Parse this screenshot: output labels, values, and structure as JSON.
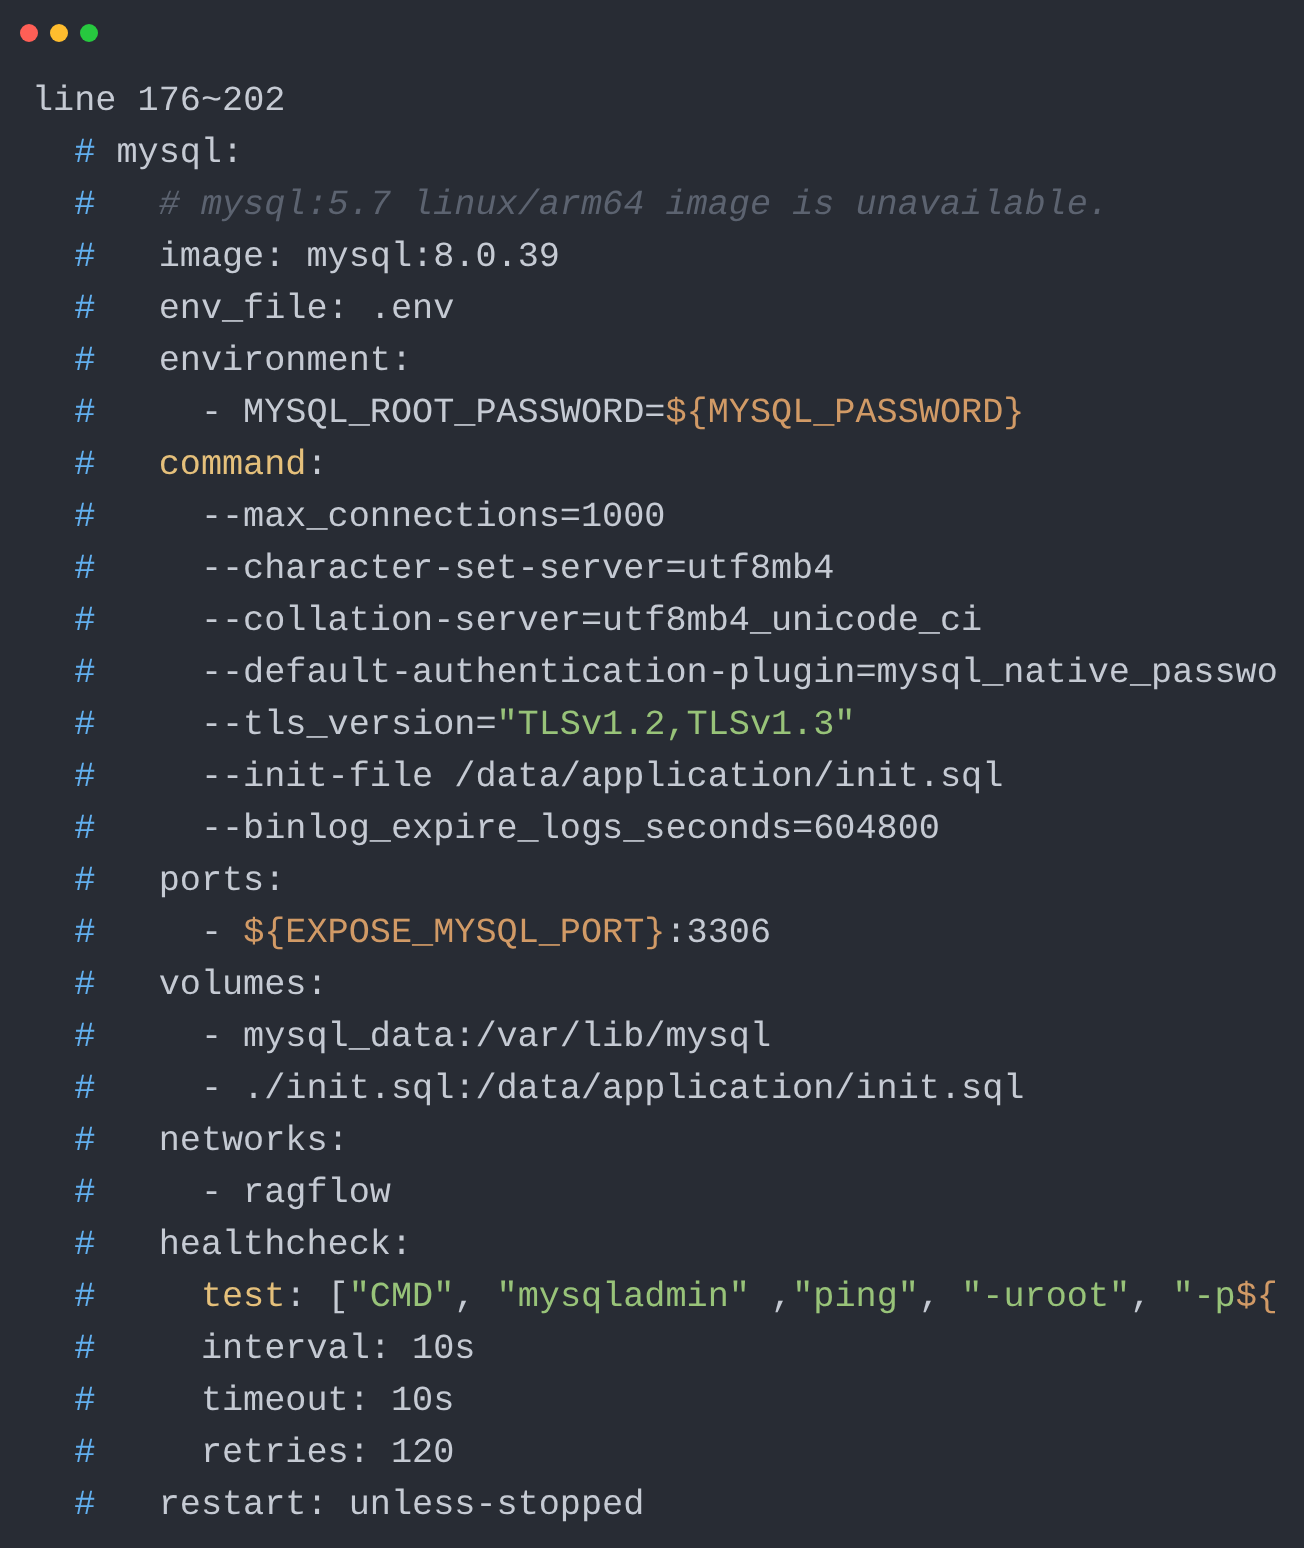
{
  "window": {
    "controls": [
      {
        "color": "#ff5f56"
      },
      {
        "color": "#ffbd2e"
      },
      {
        "color": "#27c93f"
      }
    ]
  },
  "header": "line 176~202",
  "lines": [
    {
      "marker": "#",
      "tokens": [
        {
          "kind": "plain",
          "text": "mysql:"
        }
      ],
      "children": [
        {
          "marker": "#",
          "tokens": [
            {
              "kind": "comment",
              "text": "# mysql:5.7 linux/arm64 image is unavailable."
            }
          ]
        },
        {
          "marker": "#",
          "tokens": [
            {
              "kind": "plain",
              "text": "image: mysql:8.0.39"
            }
          ]
        },
        {
          "marker": "#",
          "tokens": [
            {
              "kind": "plain",
              "text": "env_file: .env"
            }
          ]
        },
        {
          "marker": "#",
          "tokens": [
            {
              "kind": "plain",
              "text": "environment:"
            }
          ],
          "children": [
            {
              "marker": "#",
              "tokens": [
                {
                  "kind": "plain",
                  "text": "- MYSQL_ROOT_PASSWORD="
                },
                {
                  "kind": "variable",
                  "text": "${MYSQL_PASSWORD}"
                }
              ]
            }
          ]
        },
        {
          "marker": "#",
          "tokens": [
            {
              "kind": "key",
              "text": "command"
            },
            {
              "kind": "plain",
              "text": ":"
            }
          ],
          "children": [
            {
              "marker": "#",
              "tokens": [
                {
                  "kind": "plain",
                  "text": "--max_connections=1000"
                }
              ]
            },
            {
              "marker": "#",
              "tokens": [
                {
                  "kind": "plain",
                  "text": "--character-set-server=utf8mb4"
                }
              ]
            },
            {
              "marker": "#",
              "tokens": [
                {
                  "kind": "plain",
                  "text": "--collation-server=utf8mb4_unicode_ci"
                }
              ]
            },
            {
              "marker": "#",
              "tokens": [
                {
                  "kind": "plain",
                  "text": "--default-authentication-plugin=mysql_native_passwo"
                }
              ]
            },
            {
              "marker": "#",
              "tokens": [
                {
                  "kind": "plain",
                  "text": "--tls_version="
                },
                {
                  "kind": "string",
                  "text": "\"TLSv1.2,TLSv1.3\""
                }
              ]
            },
            {
              "marker": "#",
              "tokens": [
                {
                  "kind": "plain",
                  "text": "--init-file /data/application/init.sql"
                }
              ]
            },
            {
              "marker": "#",
              "tokens": [
                {
                  "kind": "plain",
                  "text": "--binlog_expire_logs_seconds=604800"
                }
              ]
            }
          ]
        },
        {
          "marker": "#",
          "tokens": [
            {
              "kind": "plain",
              "text": "ports:"
            }
          ],
          "children": [
            {
              "marker": "#",
              "tokens": [
                {
                  "kind": "plain",
                  "text": "- "
                },
                {
                  "kind": "variable",
                  "text": "${EXPOSE_MYSQL_PORT}"
                },
                {
                  "kind": "plain",
                  "text": ":3306"
                }
              ]
            }
          ]
        },
        {
          "marker": "#",
          "tokens": [
            {
              "kind": "plain",
              "text": "volumes:"
            }
          ],
          "children": [
            {
              "marker": "#",
              "tokens": [
                {
                  "kind": "plain",
                  "text": "- mysql_data:/var/lib/mysql"
                }
              ]
            },
            {
              "marker": "#",
              "tokens": [
                {
                  "kind": "plain",
                  "text": "- ./init.sql:/data/application/init.sql"
                }
              ]
            }
          ]
        },
        {
          "marker": "#",
          "tokens": [
            {
              "kind": "plain",
              "text": "networks:"
            }
          ],
          "children": [
            {
              "marker": "#",
              "tokens": [
                {
                  "kind": "plain",
                  "text": "- ragflow"
                }
              ]
            }
          ]
        },
        {
          "marker": "#",
          "tokens": [
            {
              "kind": "plain",
              "text": "healthcheck:"
            }
          ],
          "children": [
            {
              "marker": "#",
              "tokens": [
                {
                  "kind": "key",
                  "text": "test"
                },
                {
                  "kind": "plain",
                  "text": ": ["
                },
                {
                  "kind": "string",
                  "text": "\"CMD\""
                },
                {
                  "kind": "plain",
                  "text": ", "
                },
                {
                  "kind": "string",
                  "text": "\"mysqladmin\""
                },
                {
                  "kind": "plain",
                  "text": " ,"
                },
                {
                  "kind": "string",
                  "text": "\"ping\""
                },
                {
                  "kind": "plain",
                  "text": ", "
                },
                {
                  "kind": "string",
                  "text": "\"-uroot\""
                },
                {
                  "kind": "plain",
                  "text": ", "
                },
                {
                  "kind": "string",
                  "text": "\"-p"
                },
                {
                  "kind": "variable",
                  "text": "${"
                }
              ]
            },
            {
              "marker": "#",
              "tokens": [
                {
                  "kind": "plain",
                  "text": "interval: 10s"
                }
              ]
            },
            {
              "marker": "#",
              "tokens": [
                {
                  "kind": "plain",
                  "text": "timeout: 10s"
                }
              ]
            },
            {
              "marker": "#",
              "tokens": [
                {
                  "kind": "plain",
                  "text": "retries: 120"
                }
              ]
            }
          ]
        },
        {
          "marker": "#",
          "tokens": [
            {
              "kind": "plain",
              "text": "restart: unless-stopped"
            }
          ]
        }
      ]
    }
  ]
}
